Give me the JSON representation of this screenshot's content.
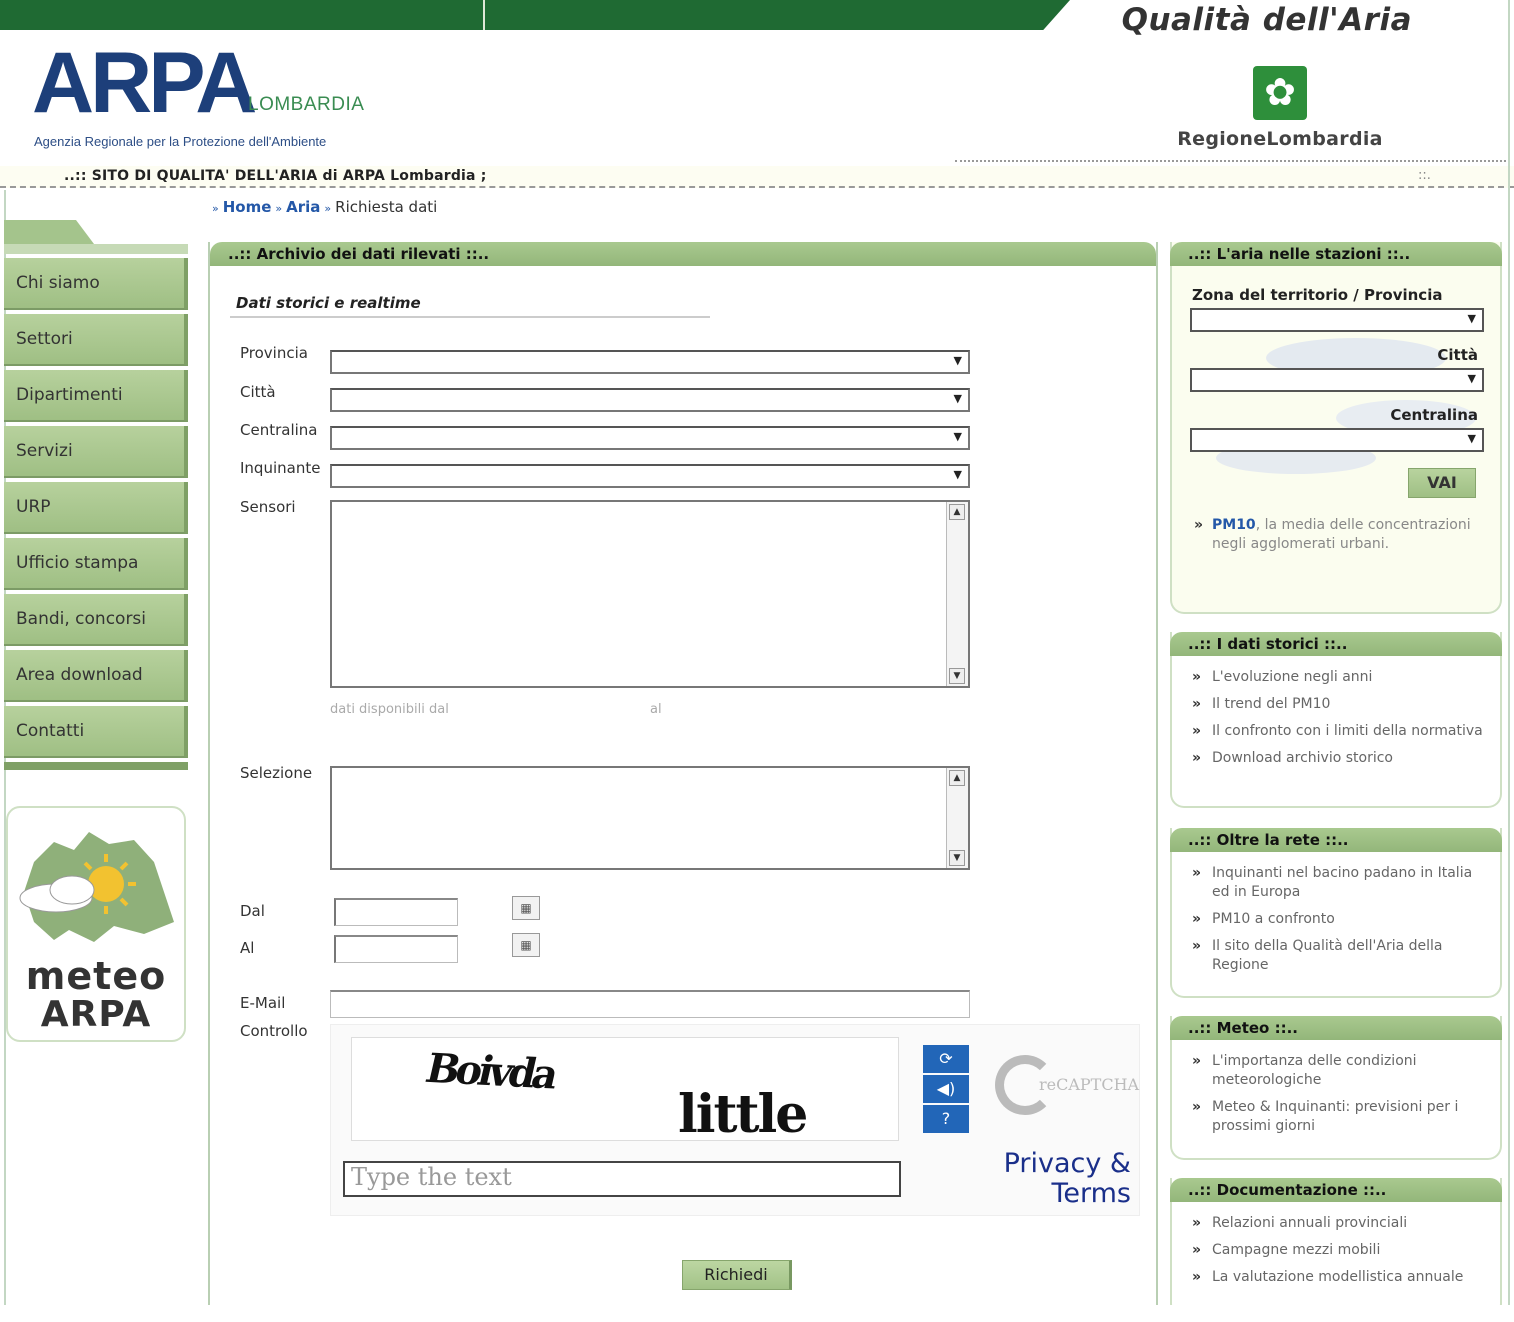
{
  "header": {
    "site_title": "Qualità dell'Aria",
    "logo_mark": "ARPA",
    "logo_region": "LOMBARDIA",
    "logo_tagline": "Agenzia Regionale per la Protezione dell'Ambiente",
    "regione_name": "RegioneLombardia",
    "subtitle": "..:: SITO DI QUALITA' DELL'ARIA di ARPA Lombardia ;",
    "subtitle_right": "::."
  },
  "breadcrumb": {
    "home": "Home",
    "aria": "Aria",
    "current": "Richiesta dati"
  },
  "sidebar": {
    "items": [
      "Chi siamo",
      "Settori",
      "Dipartimenti",
      "Servizi",
      "URP",
      "Ufficio stampa",
      "Bandi, concorsi",
      "Area download",
      "Contatti"
    ]
  },
  "meteo": {
    "line1": "meteo",
    "line2": "ARPA"
  },
  "main": {
    "title": "..:: Archivio dei dati rilevati ::..",
    "subtitle": "Dati storici e realtime",
    "labels": {
      "provincia": "Provincia",
      "citta": "Città",
      "centralina": "Centralina",
      "inquinante": "Inquinante",
      "sensori": "Sensori",
      "selezione": "Selezione",
      "dal": "Dal",
      "al": "Al",
      "email": "E-Mail",
      "controllo": "Controllo"
    },
    "availability": {
      "prefix": "dati disponibili dal",
      "suffix": "al"
    },
    "calendar_icon": "calendar-icon",
    "captcha": {
      "word1": "Boivda",
      "word2": "little",
      "placeholder": "Type the text",
      "privacy": "Privacy & Terms",
      "logo_text": "reCAPTCHA",
      "buttons": [
        "refresh-icon",
        "audio-icon",
        "help-icon"
      ]
    },
    "submit": "Richiedi"
  },
  "right": {
    "stazioni": {
      "title": "..:: L'aria nelle stazioni ::..",
      "zona_label": "Zona del territorio / Provincia",
      "citta_label": "Città",
      "centralina_label": "Centralina",
      "vai": "VAI",
      "pm10_bold": "PM10",
      "pm10_text": ", la media delle concentrazioni negli agglomerati urbani."
    },
    "storici": {
      "title": "..:: I dati storici ::..",
      "items": [
        "L'evoluzione negli anni",
        "Il trend del PM10",
        "Il confronto con i limiti della normativa",
        "Download archivio storico"
      ]
    },
    "rete": {
      "title": "..:: Oltre la rete ::..",
      "items": [
        "Inquinanti nel bacino padano in Italia ed in Europa",
        "PM10 a confronto",
        "Il sito della Qualità dell'Aria della Regione"
      ]
    },
    "meteo": {
      "title": "..:: Meteo ::..",
      "items": [
        "L'importanza delle condizioni meteorologiche",
        "Meteo & Inquinanti: previsioni per i prossimi giorni"
      ]
    },
    "documentazione": {
      "title": "..:: Documentazione ::..",
      "items": [
        "Relazioni annuali provinciali",
        "Campagne mezzi mobili",
        "La valutazione modellistica annuale"
      ]
    }
  }
}
